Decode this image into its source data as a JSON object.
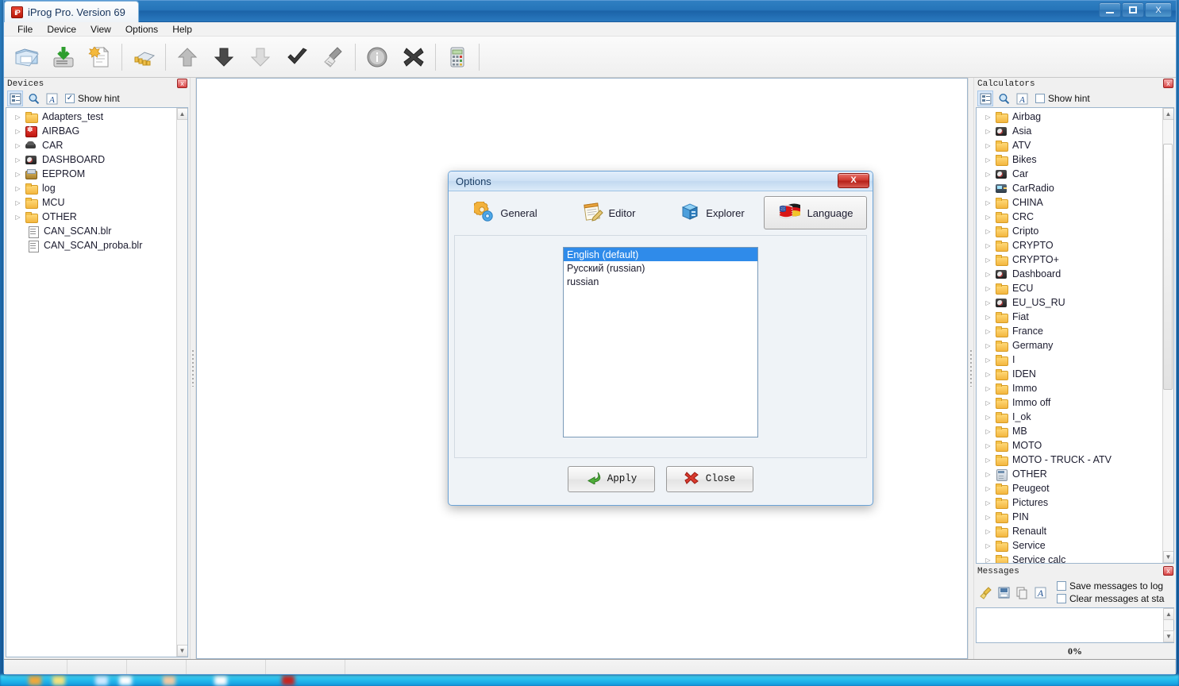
{
  "window": {
    "title": "iProg Pro. Version 69",
    "app_icon": "iP",
    "minimize_label": "Minimize",
    "maximize_label": "Maximize",
    "close_label": "X"
  },
  "menubar": {
    "items": [
      {
        "label": "File"
      },
      {
        "label": "Device"
      },
      {
        "label": "View"
      },
      {
        "label": "Options"
      },
      {
        "label": "Help"
      }
    ]
  },
  "toolbar": {
    "buttons": [
      {
        "name": "open-file-icon",
        "title": "Open"
      },
      {
        "name": "read-device-icon",
        "title": "Read"
      },
      {
        "name": "new-file-icon",
        "title": "New"
      },
      {
        "name": "chip-icon",
        "title": "Chip"
      },
      {
        "name": "arrow-up-icon",
        "title": "Up"
      },
      {
        "name": "arrow-down-icon",
        "title": "Down"
      },
      {
        "name": "arrow-down-light-icon",
        "title": "Write"
      },
      {
        "name": "check-icon",
        "title": "Verify"
      },
      {
        "name": "broom-icon",
        "title": "Erase"
      },
      {
        "name": "info-icon",
        "title": "Info"
      },
      {
        "name": "cancel-icon",
        "title": "Cancel"
      },
      {
        "name": "calculator-icon",
        "title": "Calculator"
      }
    ]
  },
  "devices_panel": {
    "title": "Devices",
    "close_label": "x",
    "show_hint_label": "Show hint",
    "show_hint_checked": true,
    "check_glyph": "✓",
    "tools": [
      {
        "name": "tree-view-icon"
      },
      {
        "name": "search-icon"
      },
      {
        "name": "font-icon"
      }
    ],
    "tree": [
      {
        "label": "Adapters_test",
        "icon": "folder",
        "expandable": true
      },
      {
        "label": "AIRBAG",
        "icon": "airbag",
        "expandable": true
      },
      {
        "label": "CAR",
        "icon": "car",
        "expandable": true
      },
      {
        "label": "DASHBOARD",
        "icon": "dash",
        "expandable": true
      },
      {
        "label": "EEPROM",
        "icon": "eeprom",
        "expandable": true
      },
      {
        "label": "log",
        "icon": "folder",
        "expandable": true
      },
      {
        "label": "MCU",
        "icon": "folder",
        "expandable": true
      },
      {
        "label": "OTHER",
        "icon": "folder",
        "expandable": true
      },
      {
        "label": "CAN_SCAN.blr",
        "icon": "file",
        "expandable": false
      },
      {
        "label": "CAN_SCAN_proba.blr",
        "icon": "file",
        "expandable": false
      }
    ]
  },
  "calculators_panel": {
    "title": "Calculators",
    "close_label": "x",
    "show_hint_label": "Show hint",
    "show_hint_checked": false,
    "tools": [
      {
        "name": "tree-view-icon"
      },
      {
        "name": "search-icon"
      },
      {
        "name": "font-icon"
      }
    ],
    "tree": [
      {
        "label": "Airbag",
        "icon": "folder"
      },
      {
        "label": "Asia",
        "icon": "dash"
      },
      {
        "label": "ATV",
        "icon": "folder"
      },
      {
        "label": "Bikes",
        "icon": "folder"
      },
      {
        "label": "Car",
        "icon": "dash"
      },
      {
        "label": "CarRadio",
        "icon": "radio"
      },
      {
        "label": "CHINA",
        "icon": "folder"
      },
      {
        "label": "CRC",
        "icon": "folder"
      },
      {
        "label": "Cripto",
        "icon": "folder"
      },
      {
        "label": "CRYPTO",
        "icon": "folder"
      },
      {
        "label": "CRYPTO+",
        "icon": "folder"
      },
      {
        "label": "Dashboard",
        "icon": "dash"
      },
      {
        "label": "ECU",
        "icon": "folder"
      },
      {
        "label": "EU_US_RU",
        "icon": "dash"
      },
      {
        "label": "Fiat",
        "icon": "folder"
      },
      {
        "label": "France",
        "icon": "folder"
      },
      {
        "label": "Germany",
        "icon": "folder"
      },
      {
        "label": "I",
        "icon": "folder"
      },
      {
        "label": "IDEN",
        "icon": "folder"
      },
      {
        "label": "Immo",
        "icon": "folder"
      },
      {
        "label": "Immo off",
        "icon": "folder"
      },
      {
        "label": "I_ok",
        "icon": "folder"
      },
      {
        "label": "MB",
        "icon": "folder"
      },
      {
        "label": "MOTO",
        "icon": "folder"
      },
      {
        "label": "MOTO - TRUCK - ATV",
        "icon": "folder"
      },
      {
        "label": "OTHER",
        "icon": "calcico"
      },
      {
        "label": "Peugeot",
        "icon": "folder"
      },
      {
        "label": "Pictures",
        "icon": "folder"
      },
      {
        "label": "PIN",
        "icon": "folder"
      },
      {
        "label": "Renault",
        "icon": "folder"
      },
      {
        "label": "Service",
        "icon": "folder"
      },
      {
        "label": "Service calc",
        "icon": "folder"
      }
    ]
  },
  "messages_panel": {
    "title": "Messages",
    "close_label": "x",
    "tools": [
      {
        "name": "broom-icon"
      },
      {
        "name": "save-icon"
      },
      {
        "name": "copy-icon"
      },
      {
        "name": "font-icon"
      }
    ],
    "checkboxes": [
      {
        "label": "Save messages to log",
        "checked": false
      },
      {
        "label": "Clear messages at sta",
        "checked": false
      }
    ],
    "log_text": "",
    "progress_label": "0%"
  },
  "statusbar": {
    "segments": [
      "",
      "",
      "",
      "",
      "",
      ""
    ]
  },
  "options_dialog": {
    "title": "Options",
    "close_label": "X",
    "tabs": [
      {
        "label": "General",
        "icon": "gears-icon",
        "active": false
      },
      {
        "label": "Editor",
        "icon": "notepad-icon",
        "active": false
      },
      {
        "label": "Explorer",
        "icon": "cube-icon",
        "active": false
      },
      {
        "label": "Language",
        "icon": "flags-icon",
        "active": true
      }
    ],
    "language_list": [
      {
        "label": "English (default)",
        "selected": true
      },
      {
        "label": "Русский (russian)",
        "selected": false
      },
      {
        "label": "russian",
        "selected": false
      }
    ],
    "apply_label": "Apply",
    "close_button_label": "Close"
  },
  "colors": {
    "accent_blue": "#2f8bea",
    "title_blue": "#2574b8",
    "panel_gray": "#f0f0f0",
    "folder_yellow": "#f3b63f",
    "close_red": "#cf3b32"
  }
}
